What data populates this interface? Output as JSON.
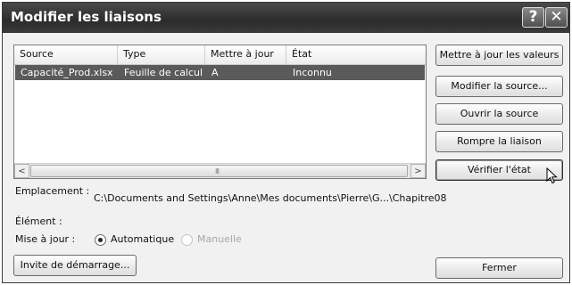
{
  "window": {
    "title": "Modifier les liaisons",
    "help_glyph": "?",
    "close_glyph": "✕"
  },
  "links_table": {
    "columns": [
      "Source",
      "Type",
      "Mettre à jour",
      "État"
    ],
    "rows": [
      {
        "source": "Capacité_Prod.xlsx",
        "type": "Feuille de calcul",
        "update": "A",
        "state": "Inconnu",
        "selected": true
      }
    ]
  },
  "scrollbar": {
    "left_arrow": "<",
    "right_arrow": ">",
    "grip": "III"
  },
  "buttons": {
    "update_values": "Mettre à jour les valeurs",
    "change_source": "Modifier la source...",
    "open_source": "Ouvrir la source",
    "break_link": "Rompre la liaison",
    "check_status": "Vérifier l'état",
    "startup_prompt": "Invite de démarrage...",
    "close": "Fermer"
  },
  "details": {
    "location_label": "Emplacement :",
    "location_value": "C:\\Documents and Settings\\Anne\\Mes documents\\Pierre\\G...\\Chapitre08",
    "element_label": "Élément :",
    "element_value": "",
    "update_label": "Mise à jour :",
    "update_options": [
      {
        "label": "Automatique",
        "selected": true,
        "enabled": true
      },
      {
        "label": "Manuelle",
        "selected": false,
        "enabled": false
      }
    ]
  }
}
